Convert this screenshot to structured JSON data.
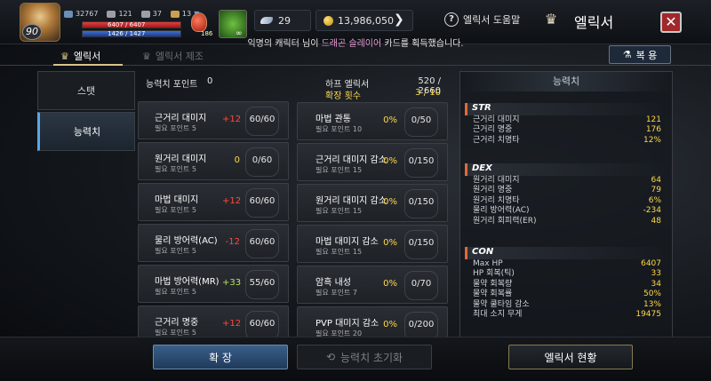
{
  "player": {
    "level": "90",
    "combat_power": "32767",
    "stat_a": "121",
    "stat_b": "37",
    "stat_c": "13",
    "hp_text": "6407 / 6407",
    "mp_text": "1426 / 1427",
    "potion_count": "186",
    "buff_symbol": "∞"
  },
  "currency": {
    "feather_count": "29",
    "gold": "13,986,050"
  },
  "header": {
    "help_label": "엘릭서 도움말",
    "title": "엘릭서",
    "close_label": "✕"
  },
  "notice": {
    "prefix": "익명의 캐릭터 님이 ",
    "item": "드래곤 슬레이어",
    "suffix": " 카드를 획득했습니다."
  },
  "tabs": {
    "tab1": "엘릭서",
    "tab2": "엘릭서 제조",
    "restore_label": "복 용"
  },
  "nav": {
    "item1": "스탯",
    "item2": "능력치"
  },
  "main": {
    "points_label": "능력치 포인트",
    "points_value": "0",
    "elixir_label": "하프 엘릭서",
    "elixir_value": "520 / 2660",
    "expand_label": "확장 횟수",
    "expand_value": "3 / 10"
  },
  "left_cards": [
    {
      "name": "근거리 대미지",
      "sub": "필요 포인트 5",
      "bonus": "+12",
      "level": "60/60",
      "color": "red"
    },
    {
      "name": "원거리 대미지",
      "sub": "필요 포인트 5",
      "bonus": "0",
      "level": "0/60",
      "color": "yel"
    },
    {
      "name": "마법 대미지",
      "sub": "필요 포인트 5",
      "bonus": "+12",
      "level": "60/60",
      "color": "red"
    },
    {
      "name": "물리 방어력(AC)",
      "sub": "필요 포인트 5",
      "bonus": "-12",
      "level": "60/60",
      "color": "red"
    },
    {
      "name": "마법 방어력(MR)",
      "sub": "필요 포인트 5",
      "bonus": "+33",
      "level": "55/60",
      "color": "grn"
    },
    {
      "name": "근거리 명중",
      "sub": "필요 포인트 5",
      "bonus": "+12",
      "level": "60/60",
      "color": "red"
    }
  ],
  "mid_cards": [
    {
      "name": "마법 관통",
      "sub": "필요 포인트 10",
      "bonus": "0%",
      "level": "0/50"
    },
    {
      "name": "근거리 대미지 감소",
      "sub": "필요 포인트 15",
      "bonus": "0%",
      "level": "0/150"
    },
    {
      "name": "원거리 대미지 감소",
      "sub": "필요 포인트 15",
      "bonus": "0%",
      "level": "0/150"
    },
    {
      "name": "마법 대미지 감소",
      "sub": "필요 포인트 15",
      "bonus": "0%",
      "level": "0/150"
    },
    {
      "name": "암흑 내성",
      "sub": "필요 포인트 7",
      "bonus": "0%",
      "level": "0/70"
    },
    {
      "name": "PVP 대미지 감소",
      "sub": "필요 포인트 20",
      "bonus": "0%",
      "level": "0/200"
    }
  ],
  "right_panel": {
    "title": "능력치",
    "groups": [
      {
        "name": "STR",
        "rows": [
          [
            "근거리 대미지",
            "121"
          ],
          [
            "근거리 명중",
            "176"
          ],
          [
            "근거리 치명타",
            "12%"
          ]
        ]
      },
      {
        "name": "DEX",
        "rows": [
          [
            "원거리 대미지",
            "64"
          ],
          [
            "원거리 명중",
            "79"
          ],
          [
            "원거리 치명타",
            "6%"
          ],
          [
            "물리 방어력(AC)",
            "-234"
          ],
          [
            "원거리 회피력(ER)",
            "48"
          ]
        ]
      },
      {
        "name": "CON",
        "rows": [
          [
            "Max HP",
            "6407"
          ],
          [
            "HP 회복(틱)",
            "33"
          ],
          [
            "물약 회복량",
            "34"
          ],
          [
            "물약 회복률",
            "50%"
          ],
          [
            "물약 쿨타임 감소",
            "13%"
          ],
          [
            "최대 소지 무게",
            "19475"
          ]
        ]
      }
    ]
  },
  "bottom": {
    "confirm": "확 장",
    "reset": "능력치 초기화",
    "status": "엘릭서 현황"
  },
  "colors": {
    "accent_blue": "#58a7e6",
    "bonus_red": "#ff4a3a",
    "bonus_yellow": "#ffd84a",
    "close_red": "#a0272a"
  },
  "bars": {
    "hp_fraction": 1.0,
    "mp_fraction": 0.999
  }
}
